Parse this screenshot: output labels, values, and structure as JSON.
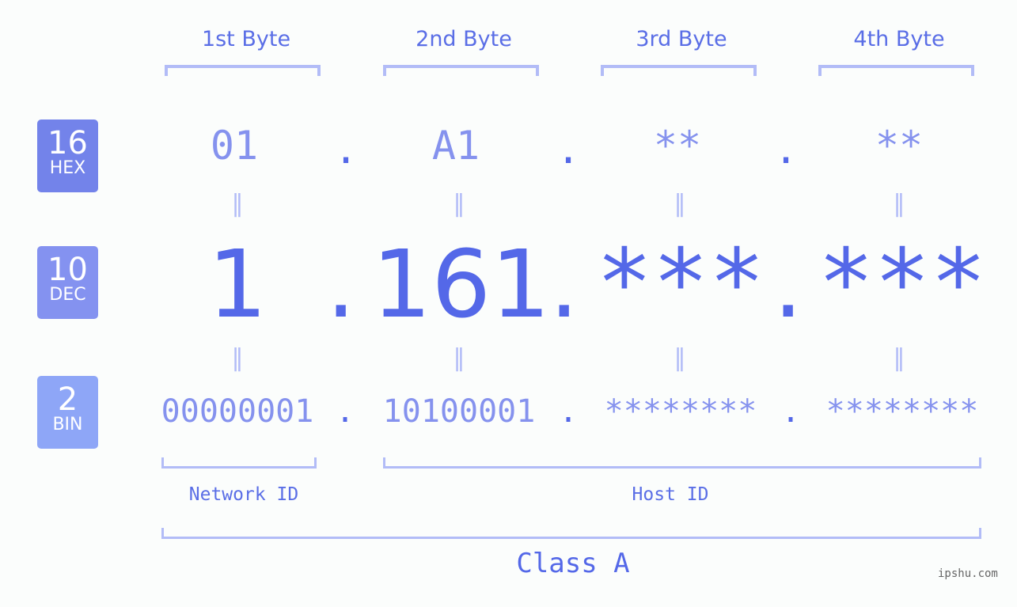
{
  "badges": [
    {
      "number": "16",
      "label": "HEX",
      "color": "#7383ea"
    },
    {
      "number": "10",
      "label": "DEC",
      "color": "#8492f0"
    },
    {
      "number": "2",
      "label": "BIN",
      "color": "#8ea6f7"
    }
  ],
  "byte_headers": [
    "1st Byte",
    "2nd Byte",
    "3rd Byte",
    "4th Byte"
  ],
  "hex": [
    "01",
    "A1",
    "**",
    "**"
  ],
  "dec": [
    "1",
    "161",
    "***",
    "***"
  ],
  "bin": [
    "00000001",
    "10100001",
    "********",
    "********"
  ],
  "separator": ".",
  "equals": "=",
  "network_id_label": "Network ID",
  "host_id_label": "Host ID",
  "class_label": "Class A",
  "watermark": "ipshu.com"
}
